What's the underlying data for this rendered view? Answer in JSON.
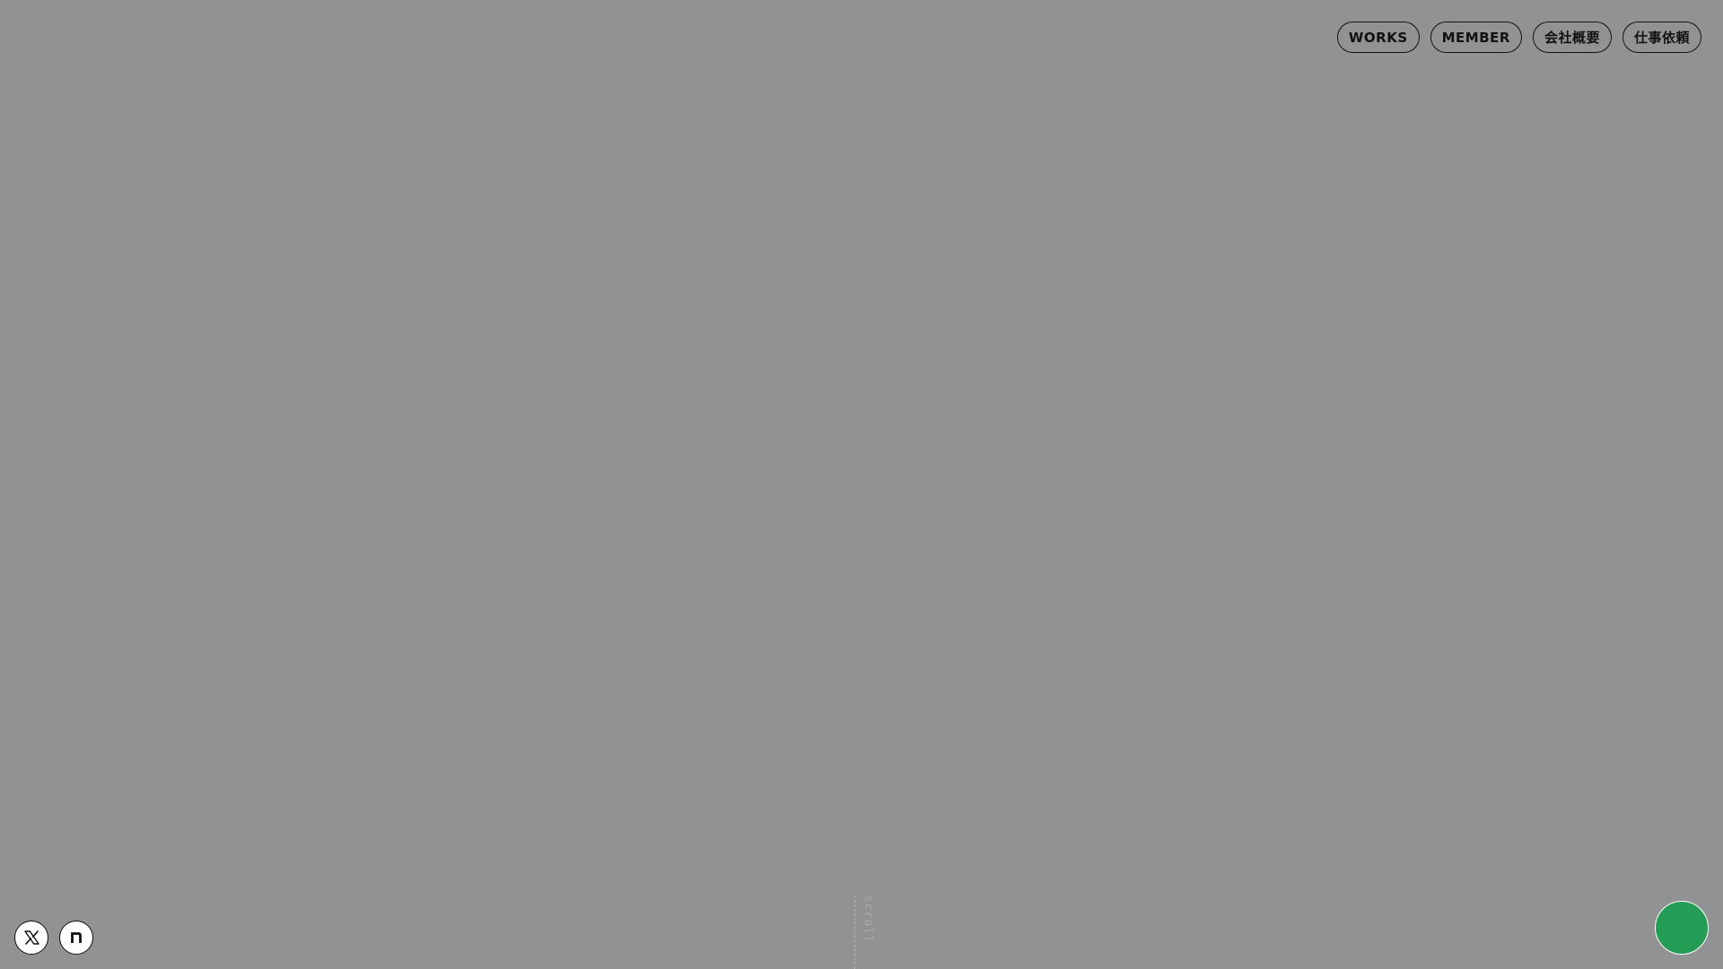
{
  "nav": {
    "items": [
      {
        "label": "WORKS"
      },
      {
        "label": "MEMBER"
      },
      {
        "label": "会社概要"
      },
      {
        "label": "仕事依頼"
      }
    ]
  },
  "social": {
    "icons": [
      "x-logo-icon",
      "note-logo-icon"
    ]
  },
  "scroll_indicator": {
    "label": "scroll"
  },
  "colors": {
    "background": "#919294",
    "accent": "#249c55",
    "text": "#111111"
  }
}
